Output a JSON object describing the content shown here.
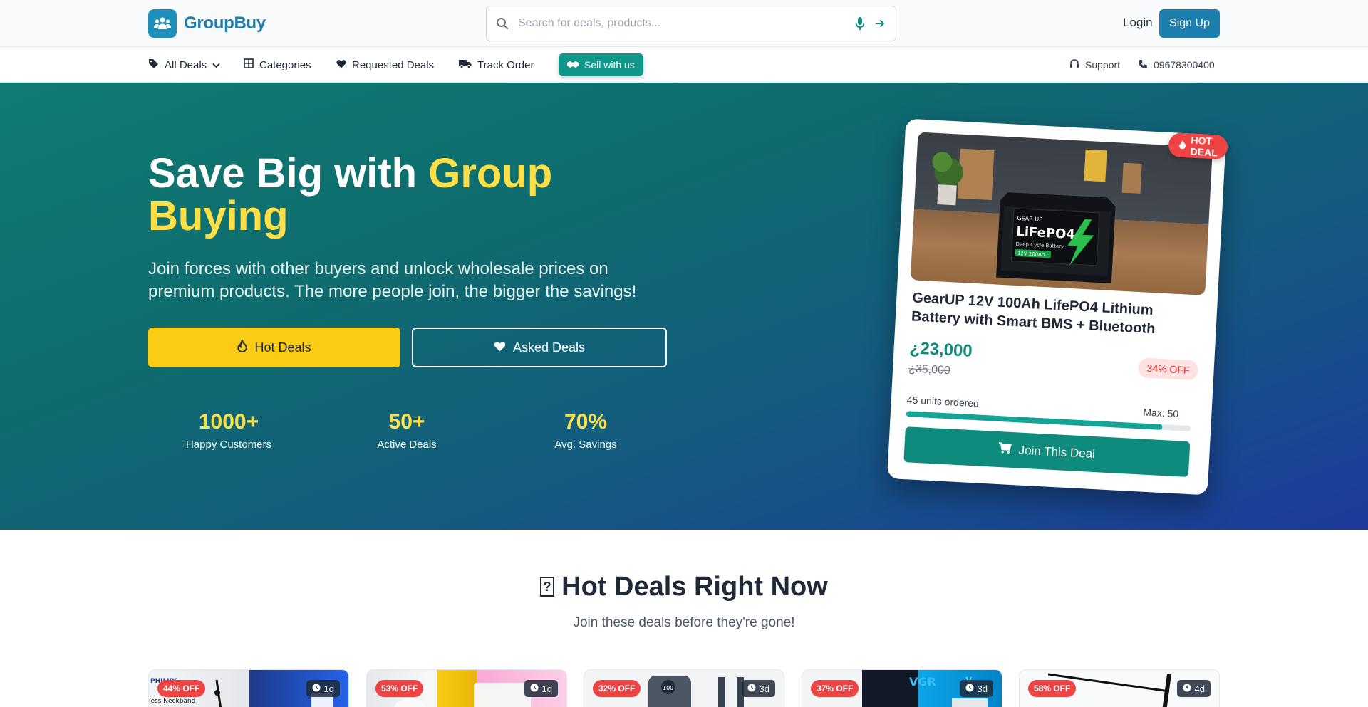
{
  "header": {
    "logo_text": "GroupBuy",
    "search_placeholder": "Search for deals, products...",
    "login_label": "Login",
    "signup_label": "Sign Up"
  },
  "nav": {
    "all_deals": "All Deals",
    "categories": "Categories",
    "requested_deals": "Requested Deals",
    "track_order": "Track Order",
    "sell_with_us": "Sell with us",
    "support": "Support",
    "phone": "09678300400"
  },
  "hero": {
    "title_prefix": "Save Big with ",
    "title_highlight": "Group Buying",
    "subtitle": "Join forces with other buyers and unlock wholesale prices on premium products. The more people join, the bigger the savings!",
    "hot_deals_label": "Hot Deals",
    "asked_deals_label": "Asked Deals",
    "stats": [
      {
        "value": "1000+",
        "label": "Happy Customers"
      },
      {
        "value": "50+",
        "label": "Active Deals"
      },
      {
        "value": "70%",
        "label": "Avg. Savings"
      }
    ]
  },
  "featured": {
    "badge": "HOT DEAL",
    "title": "GearUP 12V 100Ah LifePO4 Lithium Battery with Smart BMS + Bluetooth",
    "price": "¿23,000",
    "old_price": "¿35,000",
    "discount": "34% OFF",
    "units_ordered": "45 units ordered",
    "max": "Max: 50",
    "progress_fraction": 0.9,
    "join_label": "Join This Deal",
    "battery_brand": "GEAR UP",
    "battery_model": "LiFePO4",
    "battery_line": "Deep Cycle Battery",
    "battery_spec": "12V 100Ah"
  },
  "section": {
    "glyph": "?",
    "title": "Hot Deals Right Now",
    "subtitle": "Join these deals before they're gone!"
  },
  "deals": [
    {
      "discount": "44% OFF",
      "time": "1d",
      "img_text": "PHILIPS",
      "img_text2": "less Neckband"
    },
    {
      "discount": "53% OFF",
      "time": "1d"
    },
    {
      "discount": "32% OFF",
      "time": "3d",
      "img_text": "100"
    },
    {
      "discount": "37% OFF",
      "time": "3d",
      "img_text": "VGR",
      "img_text2": "V-"
    },
    {
      "discount": "58% OFF",
      "time": "4d"
    }
  ],
  "colors": {
    "brand": "#1d7fae",
    "teal": "#0f8b7e",
    "yellow": "#facc15",
    "red": "#ef4444"
  }
}
